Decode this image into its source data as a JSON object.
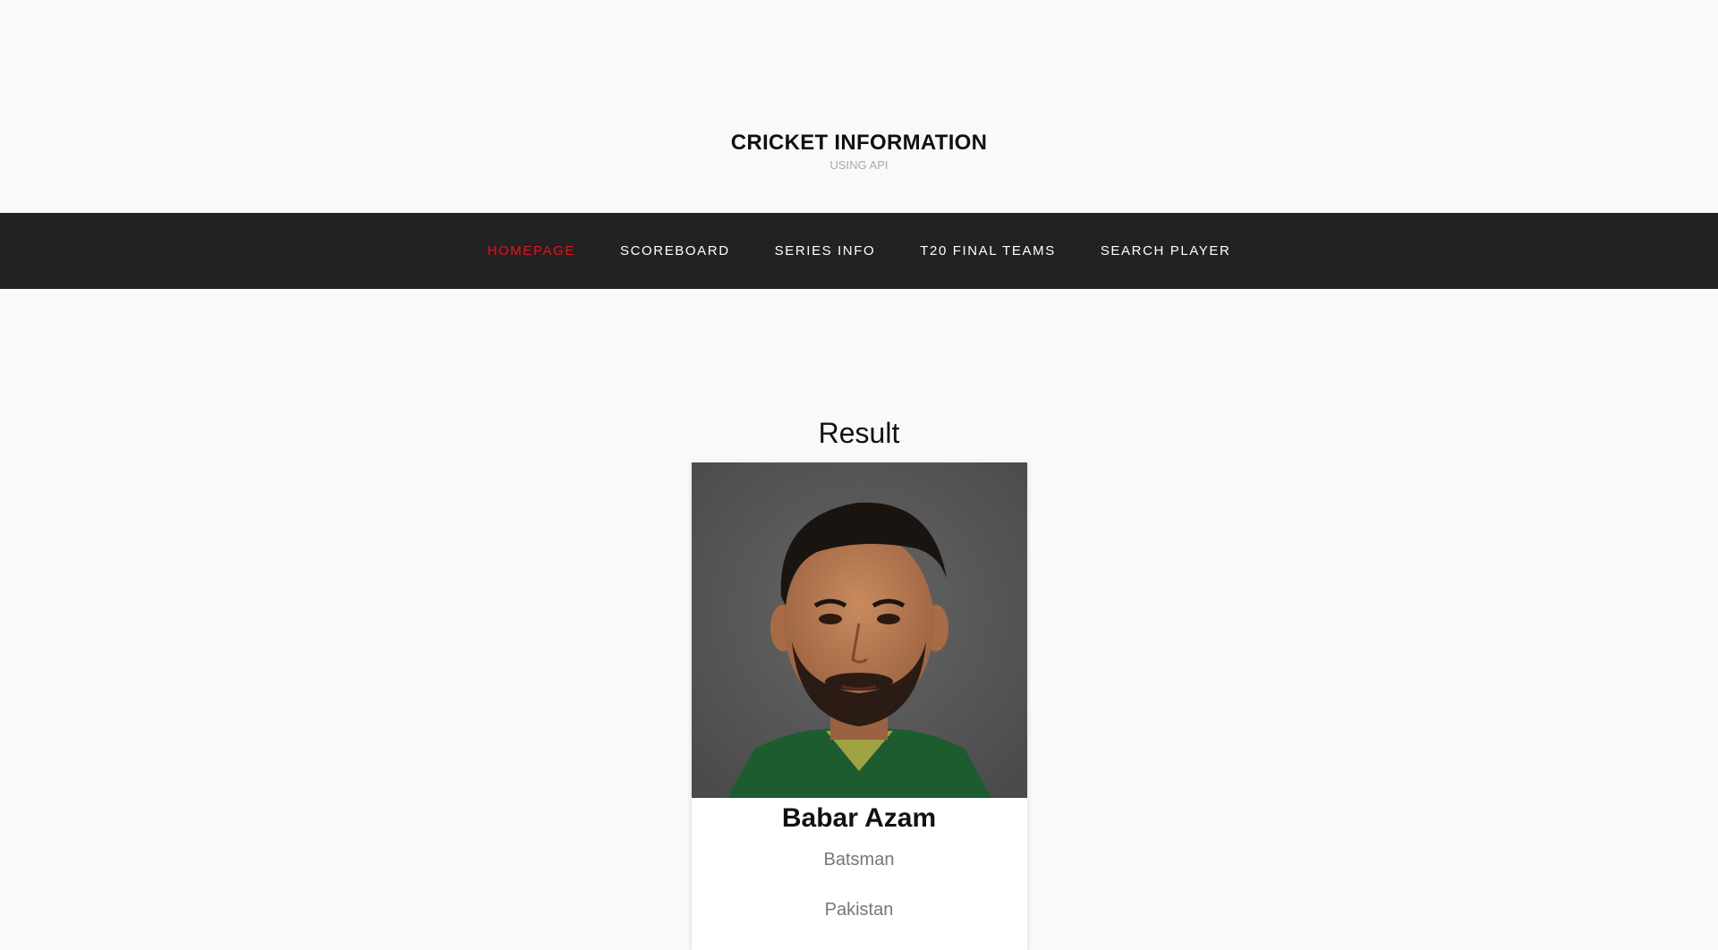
{
  "header": {
    "title": "CRICKET INFORMATION",
    "tagline": "USING API"
  },
  "nav": {
    "items": [
      {
        "label": "HOMEPAGE",
        "active": true
      },
      {
        "label": "SCOREBOARD",
        "active": false
      },
      {
        "label": "SERIES INFO",
        "active": false
      },
      {
        "label": "T20 FINAL TEAMS",
        "active": false
      },
      {
        "label": "SEARCH PLAYER",
        "active": false
      }
    ],
    "active_color": "#e8101a",
    "background": "#222222"
  },
  "main": {
    "heading": "Result",
    "player": {
      "name": "Babar Azam",
      "role": "Batsman",
      "country": "Pakistan",
      "photo_icon": "player-portrait-image"
    }
  }
}
